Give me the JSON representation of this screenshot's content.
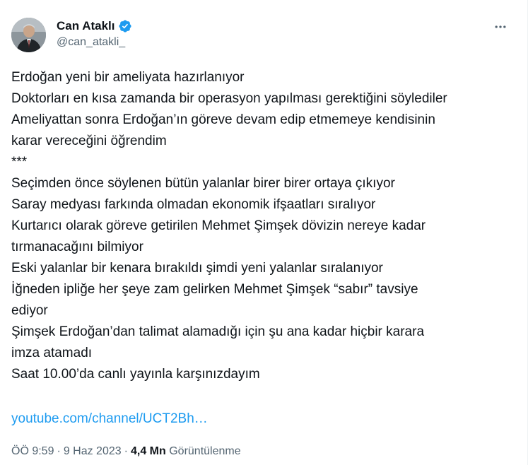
{
  "author": {
    "display_name": "Can Ataklı",
    "handle": "@can_atakli_",
    "verified_color": "#1d9bf0"
  },
  "tweet": {
    "lines": [
      "Erdoğan yeni bir ameliyata hazırlanıyor",
      "Doktorları en kısa zamanda bir operasyon yapılması gerektiğini söylediler",
      "Ameliyattan sonra Erdoğan’ın göreve devam edip etmemeye kendisinin",
      "karar vereceğini öğrendim",
      "***",
      "Seçimden önce söylenen bütün yalanlar birer birer ortaya çıkıyor",
      "Saray medyası farkında olmadan ekonomik ifşaatları sıralıyor",
      "Kurtarıcı olarak göreve getirilen Mehmet Şimşek dövizin nereye kadar",
      "tırmanacağını bilmiyor",
      "Eski yalanlar bir kenara bırakıldı şimdi yeni yalanlar sıralanıyor",
      "İğneden ipliğe her şeye zam gelirken Mehmet Şimşek “sabır” tavsiye",
      "ediyor",
      "Şimşek Erdoğan’dan talimat alamadığı için şu ana kadar hiçbir karara",
      "imza atamadı",
      "Saat 10.00’da canlı yayınla karşınızdayım"
    ],
    "link_text": "youtube.com/channel/UCT2Bh…",
    "link_color": "#1d9bf0"
  },
  "meta": {
    "time": "ÖÖ 9:59",
    "separator": "·",
    "date": "9 Haz 2023",
    "views_count": "4,4 Mn",
    "views_label": "Görüntülenme"
  },
  "icons": {
    "avatar": "profile-photo",
    "verified": "verified-badge-icon",
    "more": "more-options-icon"
  }
}
